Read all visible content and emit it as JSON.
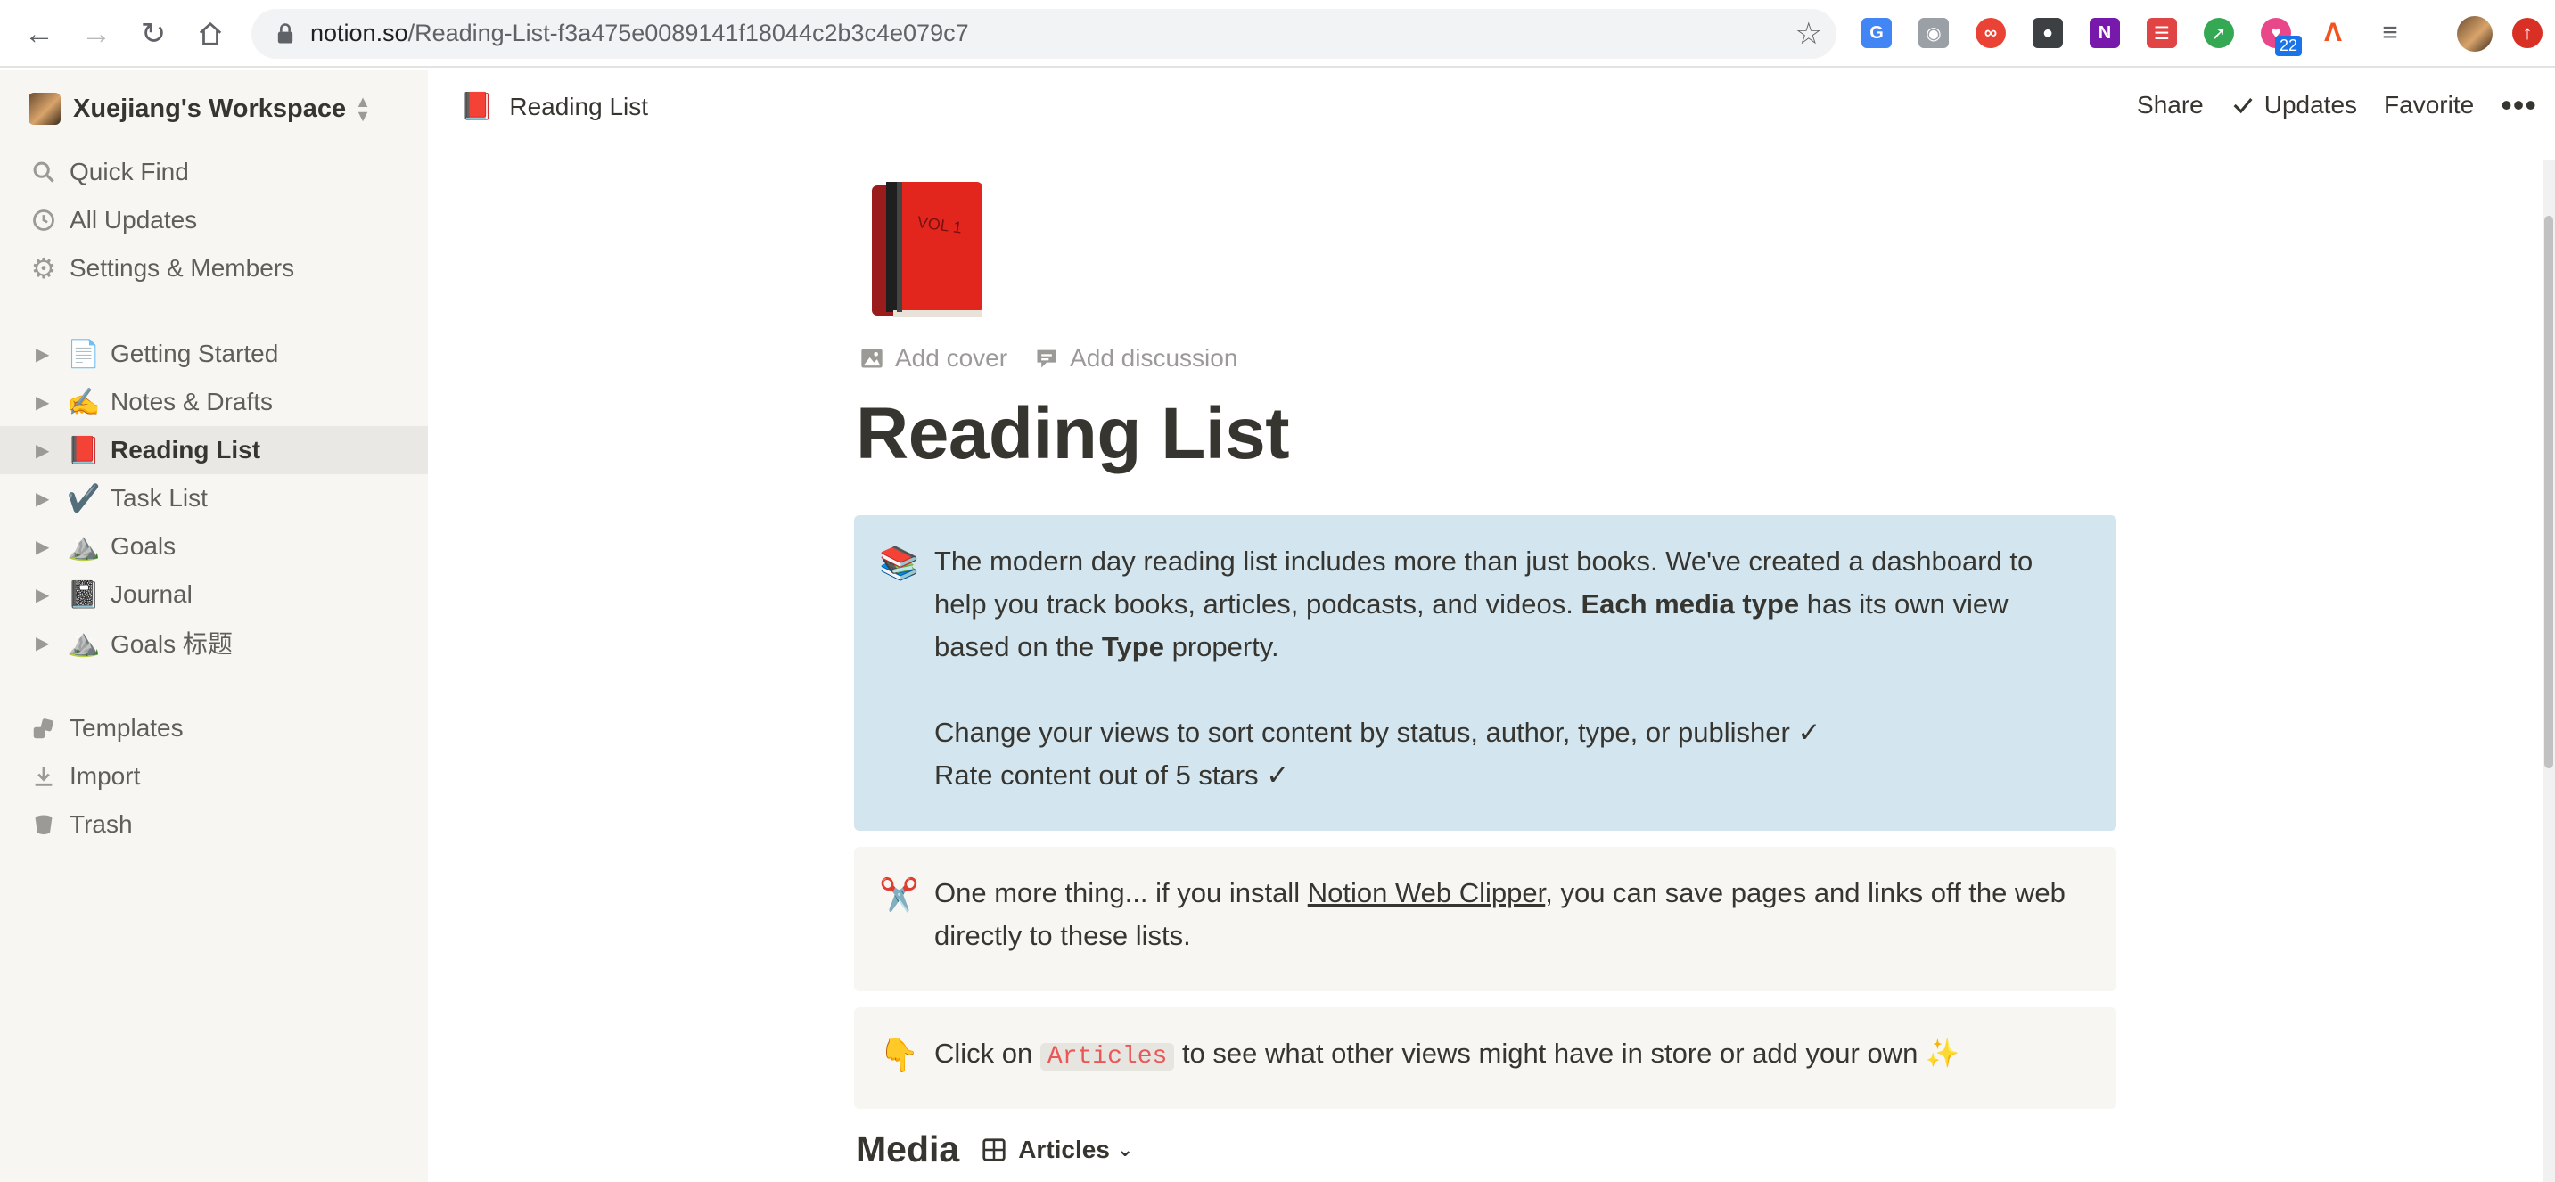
{
  "browser": {
    "url_host": "notion.so",
    "url_path": "/Reading-List-f3a475e0089141f18044c2b3c4e079c7",
    "badge_count": "22"
  },
  "sidebar": {
    "workspace_name": "Xuejiang's Workspace",
    "top_items": [
      {
        "label": "Quick Find",
        "icon": "search-icon"
      },
      {
        "label": "All Updates",
        "icon": "clock-icon"
      },
      {
        "label": "Settings & Members",
        "icon": "gear-icon"
      }
    ],
    "pages": [
      {
        "label": "Getting Started",
        "emoji": "📄"
      },
      {
        "label": "Notes & Drafts",
        "emoji": "✍️"
      },
      {
        "label": "Reading List",
        "emoji": "📕"
      },
      {
        "label": "Task List",
        "emoji": "✔️"
      },
      {
        "label": "Goals",
        "emoji": "⛰️"
      },
      {
        "label": "Journal",
        "emoji": "📓"
      },
      {
        "label": "Goals 标题",
        "emoji": "⛰️"
      }
    ],
    "bottom_items": [
      {
        "label": "Templates",
        "icon": "templates-icon"
      },
      {
        "label": "Import",
        "icon": "import-icon"
      },
      {
        "label": "Trash",
        "icon": "trash-icon"
      }
    ]
  },
  "topbar": {
    "breadcrumb_emoji": "📕",
    "breadcrumb_label": "Reading List",
    "share_label": "Share",
    "updates_label": "Updates",
    "favorite_label": "Favorite",
    "more_label": "•••"
  },
  "page": {
    "add_cover": "Add cover",
    "add_discussion": "Add discussion",
    "title": "Reading List",
    "callout1": {
      "emoji": "📚",
      "line1_part1": "The modern day reading list includes more than just books. We've created a dashboard to help you track books, articles, podcasts, and videos.",
      "bold1": "Each media type",
      "line1_part2": "has its own view based on the",
      "bold2": "Type",
      "line1_part3": "property.",
      "line2": "Change your views to sort content by status, author, type, or publisher ✓",
      "line3": "Rate content out of 5 stars ✓"
    },
    "callout2": {
      "emoji": "✂️",
      "text_before": "One more thing... if you install",
      "link": "Notion Web Clipper",
      "text_after": ", you can save pages and links off the web directly to these lists."
    },
    "callout3": {
      "emoji": "👇",
      "text_before": "Click on",
      "code": "Articles",
      "text_after": "to see what other views might have in store or add your own ✨"
    },
    "media_title": "Media",
    "view_label": "Articles"
  }
}
